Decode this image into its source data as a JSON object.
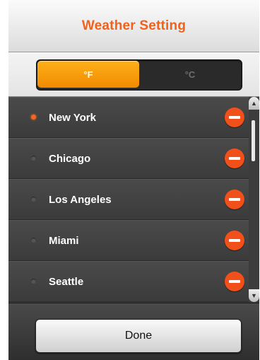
{
  "header": {
    "title": "Weather Setting"
  },
  "units": {
    "fahrenheit_label": "°F",
    "celsius_label": "°C",
    "selected": "°F"
  },
  "cities": [
    {
      "name": "New York",
      "active": true
    },
    {
      "name": "Chicago",
      "active": false
    },
    {
      "name": "Los Angeles",
      "active": false
    },
    {
      "name": "Miami",
      "active": false
    },
    {
      "name": "Seattle",
      "active": false
    }
  ],
  "scrollbar": {
    "up_icon": "▲",
    "down_icon": "▼"
  },
  "footer": {
    "done_label": "Done"
  },
  "colors": {
    "accent": "#f0621c",
    "remove": "#f2501a",
    "selected_unit": "#f5a010"
  }
}
